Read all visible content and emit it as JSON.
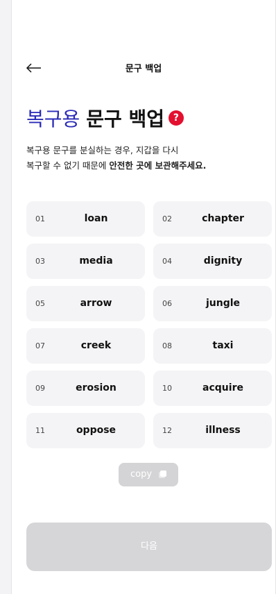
{
  "header": {
    "title": "문구 백업"
  },
  "title": {
    "accent": "복구용",
    "strong": "문구 백업",
    "help_label": "?"
  },
  "description": {
    "line1": "복구용 문구를 분실하는 경우, 지갑을 다시",
    "line2_prefix": "복구할 수 없기 때문에 ",
    "line2_bold": "안전한 곳에 보관해주세요."
  },
  "words": [
    {
      "num": "01",
      "word": "loan"
    },
    {
      "num": "02",
      "word": "chapter"
    },
    {
      "num": "03",
      "word": "media"
    },
    {
      "num": "04",
      "word": "dignity"
    },
    {
      "num": "05",
      "word": "arrow"
    },
    {
      "num": "06",
      "word": "jungle"
    },
    {
      "num": "07",
      "word": "creek"
    },
    {
      "num": "08",
      "word": "taxi"
    },
    {
      "num": "09",
      "word": "erosion"
    },
    {
      "num": "10",
      "word": "acquire"
    },
    {
      "num": "11",
      "word": "oppose"
    },
    {
      "num": "12",
      "word": "illness"
    }
  ],
  "copy_button": {
    "label": "copy"
  },
  "next_button": {
    "label": "다음"
  },
  "colors": {
    "accent": "#2a2ab8",
    "help_badge": "#e3102f",
    "disabled_button": "#d6d6d8"
  },
  "icons": {
    "back": "arrow-left-icon",
    "help": "question-icon",
    "copy": "copy-icon"
  }
}
